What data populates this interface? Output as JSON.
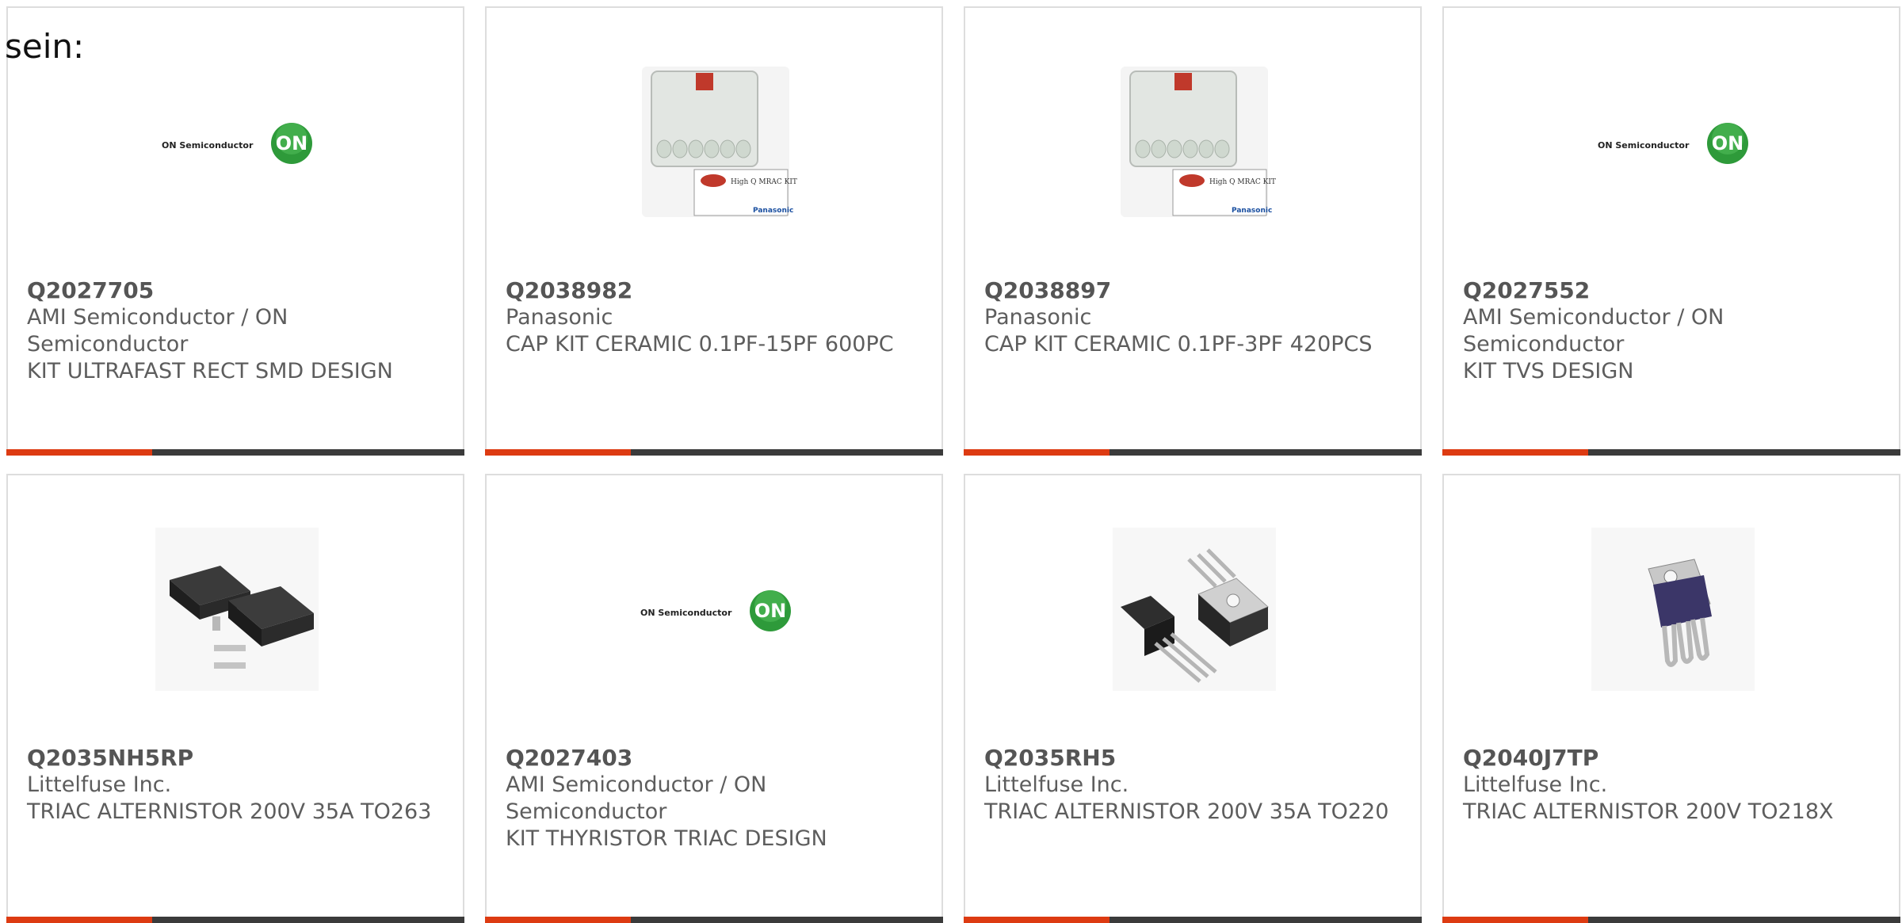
{
  "intro_text": "sein:",
  "products": [
    {
      "part": "Q2027705",
      "manufacturer": "AMI Semiconductor / ON Semiconductor",
      "description": "KIT ULTRAFAST RECT SMD DESIGN",
      "image": "on-semiconductor-logo"
    },
    {
      "part": "Q2038982",
      "manufacturer": "Panasonic",
      "description": "CAP KIT CERAMIC 0.1PF-15PF 600PC",
      "image": "capacitor-kit-box",
      "logo_text": "High Q MRAC KIT",
      "brand_text": "Panasonic"
    },
    {
      "part": "Q2038897",
      "manufacturer": "Panasonic",
      "description": "CAP KIT CERAMIC 0.1PF-3PF 420PCS",
      "image": "capacitor-kit-box",
      "logo_text": "High Q MRAC KIT",
      "brand_text": "Panasonic"
    },
    {
      "part": "Q2027552",
      "manufacturer": "AMI Semiconductor / ON Semiconductor",
      "description": "KIT TVS DESIGN",
      "image": "on-semiconductor-logo"
    },
    {
      "part": "Q2035NH5RP",
      "manufacturer": "Littelfuse Inc.",
      "description": "TRIAC ALTERNISTOR 200V 35A TO263",
      "image": "to263-package"
    },
    {
      "part": "Q2027403",
      "manufacturer": "AMI Semiconductor / ON Semiconductor",
      "description": "KIT THYRISTOR TRIAC DESIGN",
      "image": "on-semiconductor-logo"
    },
    {
      "part": "Q2035RH5",
      "manufacturer": "Littelfuse Inc.",
      "description": "TRIAC ALTERNISTOR 200V 35A TO220",
      "image": "to220-package"
    },
    {
      "part": "Q2040J7TP",
      "manufacturer": "Littelfuse Inc.",
      "description": "TRIAC ALTERNISTOR 200V TO218X",
      "image": "to218x-package"
    }
  ],
  "logo": {
    "brand_name": "ON Semiconductor",
    "mark": "ON"
  },
  "colors": {
    "accent": "#dd3b12",
    "bar": "#3b3b3b",
    "border": "#dddddd",
    "text": "#5d5d5d",
    "logo_green": "#2e9a3a"
  }
}
